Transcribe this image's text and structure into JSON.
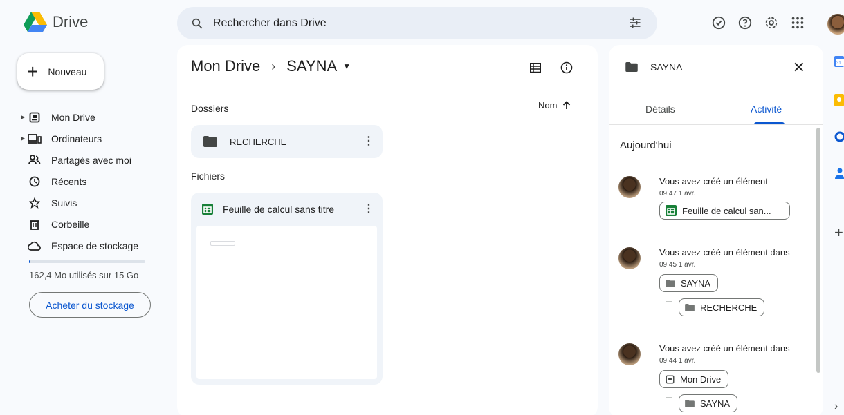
{
  "app": {
    "name": "Drive"
  },
  "search": {
    "placeholder": "Rechercher dans Drive"
  },
  "sidebar": {
    "new_label": "Nouveau",
    "items": [
      {
        "label": "Mon Drive",
        "icon": "my-drive-icon",
        "expandable": true
      },
      {
        "label": "Ordinateurs",
        "icon": "computers-icon",
        "expandable": true
      },
      {
        "label": "Partagés avec moi",
        "icon": "shared-icon",
        "expandable": false
      },
      {
        "label": "Récents",
        "icon": "clock-icon",
        "expandable": false
      },
      {
        "label": "Suivis",
        "icon": "star-icon",
        "expandable": false
      },
      {
        "label": "Corbeille",
        "icon": "trash-icon",
        "expandable": false
      },
      {
        "label": "Espace de stockage",
        "icon": "cloud-icon",
        "expandable": false
      }
    ],
    "storage_text": "162,4 Mo utilisés sur 15 Go",
    "storage_fraction": 0.0108,
    "buy_label": "Acheter du stockage"
  },
  "main": {
    "breadcrumb_root": "Mon Drive",
    "breadcrumb_sep": "›",
    "breadcrumb_current": "SAYNA",
    "folders_label": "Dossiers",
    "sort_label": "Nom",
    "folders": [
      {
        "name": "RECHERCHE"
      }
    ],
    "files_label": "Fichiers",
    "files": [
      {
        "name": "Feuille de calcul sans titre"
      }
    ]
  },
  "details": {
    "title": "SAYNA",
    "tabs": [
      "Détails",
      "Activité"
    ],
    "active_tab": "Activité",
    "section": "Aujourd'hui",
    "activities": [
      {
        "message": "Vous avez créé un élément",
        "time": "09:47 1 avr.",
        "chips": [
          "Feuille de calcul san..."
        ]
      },
      {
        "message": "Vous avez créé un élément dans",
        "time": "09:45 1 avr.",
        "chips": [
          "SAYNA",
          "RECHERCHE"
        ]
      },
      {
        "message": "Vous avez créé un élément dans",
        "time": "09:44 1 avr.",
        "chips": [
          "Mon Drive",
          "SAYNA"
        ]
      }
    ]
  },
  "colors": {
    "accent": "#0b57d0",
    "sheets_green": "#188038",
    "background": "#f8fafd"
  }
}
